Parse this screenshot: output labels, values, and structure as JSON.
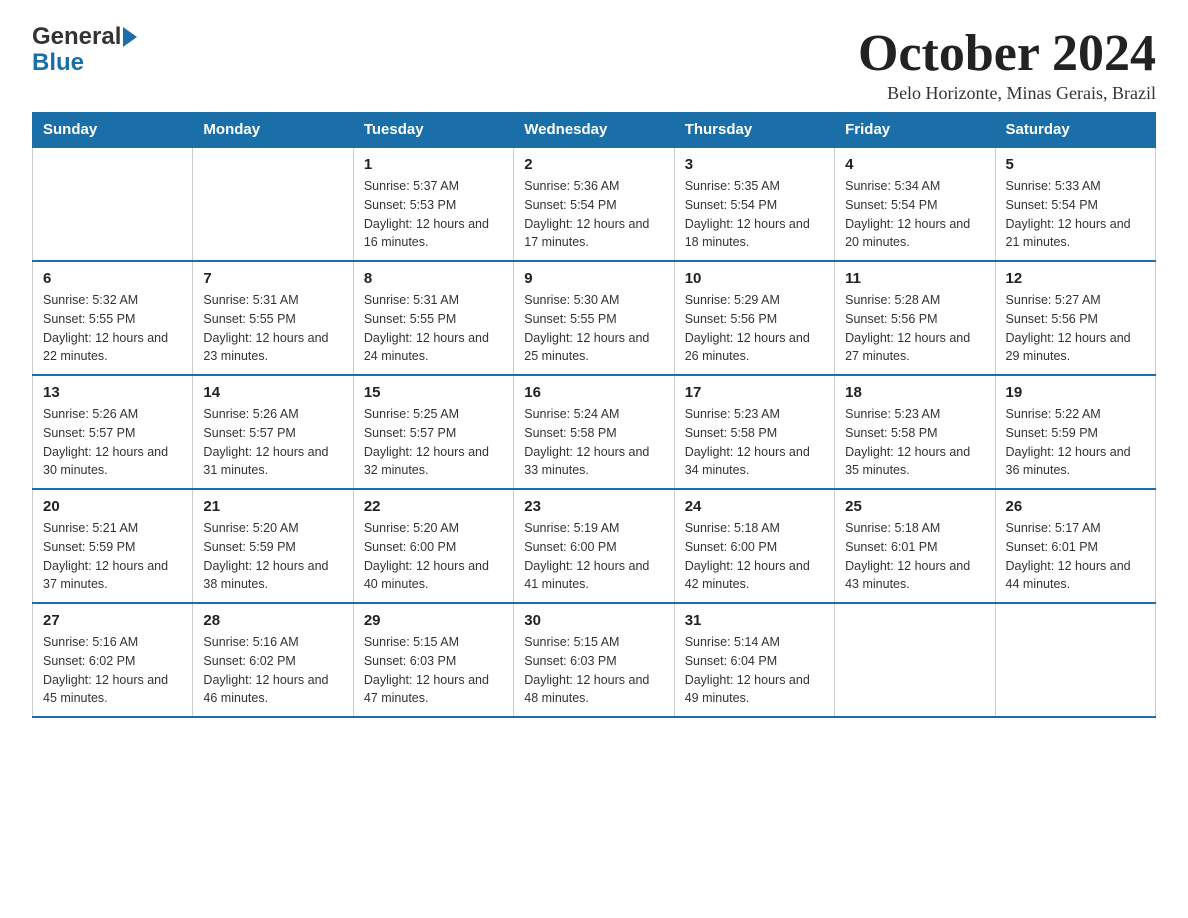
{
  "header": {
    "logo_general": "General",
    "logo_blue": "Blue",
    "month_title": "October 2024",
    "subtitle": "Belo Horizonte, Minas Gerais, Brazil"
  },
  "days_of_week": [
    "Sunday",
    "Monday",
    "Tuesday",
    "Wednesday",
    "Thursday",
    "Friday",
    "Saturday"
  ],
  "weeks": [
    [
      {
        "day": "",
        "sunrise": "",
        "sunset": "",
        "daylight": ""
      },
      {
        "day": "",
        "sunrise": "",
        "sunset": "",
        "daylight": ""
      },
      {
        "day": "1",
        "sunrise": "Sunrise: 5:37 AM",
        "sunset": "Sunset: 5:53 PM",
        "daylight": "Daylight: 12 hours and 16 minutes."
      },
      {
        "day": "2",
        "sunrise": "Sunrise: 5:36 AM",
        "sunset": "Sunset: 5:54 PM",
        "daylight": "Daylight: 12 hours and 17 minutes."
      },
      {
        "day": "3",
        "sunrise": "Sunrise: 5:35 AM",
        "sunset": "Sunset: 5:54 PM",
        "daylight": "Daylight: 12 hours and 18 minutes."
      },
      {
        "day": "4",
        "sunrise": "Sunrise: 5:34 AM",
        "sunset": "Sunset: 5:54 PM",
        "daylight": "Daylight: 12 hours and 20 minutes."
      },
      {
        "day": "5",
        "sunrise": "Sunrise: 5:33 AM",
        "sunset": "Sunset: 5:54 PM",
        "daylight": "Daylight: 12 hours and 21 minutes."
      }
    ],
    [
      {
        "day": "6",
        "sunrise": "Sunrise: 5:32 AM",
        "sunset": "Sunset: 5:55 PM",
        "daylight": "Daylight: 12 hours and 22 minutes."
      },
      {
        "day": "7",
        "sunrise": "Sunrise: 5:31 AM",
        "sunset": "Sunset: 5:55 PM",
        "daylight": "Daylight: 12 hours and 23 minutes."
      },
      {
        "day": "8",
        "sunrise": "Sunrise: 5:31 AM",
        "sunset": "Sunset: 5:55 PM",
        "daylight": "Daylight: 12 hours and 24 minutes."
      },
      {
        "day": "9",
        "sunrise": "Sunrise: 5:30 AM",
        "sunset": "Sunset: 5:55 PM",
        "daylight": "Daylight: 12 hours and 25 minutes."
      },
      {
        "day": "10",
        "sunrise": "Sunrise: 5:29 AM",
        "sunset": "Sunset: 5:56 PM",
        "daylight": "Daylight: 12 hours and 26 minutes."
      },
      {
        "day": "11",
        "sunrise": "Sunrise: 5:28 AM",
        "sunset": "Sunset: 5:56 PM",
        "daylight": "Daylight: 12 hours and 27 minutes."
      },
      {
        "day": "12",
        "sunrise": "Sunrise: 5:27 AM",
        "sunset": "Sunset: 5:56 PM",
        "daylight": "Daylight: 12 hours and 29 minutes."
      }
    ],
    [
      {
        "day": "13",
        "sunrise": "Sunrise: 5:26 AM",
        "sunset": "Sunset: 5:57 PM",
        "daylight": "Daylight: 12 hours and 30 minutes."
      },
      {
        "day": "14",
        "sunrise": "Sunrise: 5:26 AM",
        "sunset": "Sunset: 5:57 PM",
        "daylight": "Daylight: 12 hours and 31 minutes."
      },
      {
        "day": "15",
        "sunrise": "Sunrise: 5:25 AM",
        "sunset": "Sunset: 5:57 PM",
        "daylight": "Daylight: 12 hours and 32 minutes."
      },
      {
        "day": "16",
        "sunrise": "Sunrise: 5:24 AM",
        "sunset": "Sunset: 5:58 PM",
        "daylight": "Daylight: 12 hours and 33 minutes."
      },
      {
        "day": "17",
        "sunrise": "Sunrise: 5:23 AM",
        "sunset": "Sunset: 5:58 PM",
        "daylight": "Daylight: 12 hours and 34 minutes."
      },
      {
        "day": "18",
        "sunrise": "Sunrise: 5:23 AM",
        "sunset": "Sunset: 5:58 PM",
        "daylight": "Daylight: 12 hours and 35 minutes."
      },
      {
        "day": "19",
        "sunrise": "Sunrise: 5:22 AM",
        "sunset": "Sunset: 5:59 PM",
        "daylight": "Daylight: 12 hours and 36 minutes."
      }
    ],
    [
      {
        "day": "20",
        "sunrise": "Sunrise: 5:21 AM",
        "sunset": "Sunset: 5:59 PM",
        "daylight": "Daylight: 12 hours and 37 minutes."
      },
      {
        "day": "21",
        "sunrise": "Sunrise: 5:20 AM",
        "sunset": "Sunset: 5:59 PM",
        "daylight": "Daylight: 12 hours and 38 minutes."
      },
      {
        "day": "22",
        "sunrise": "Sunrise: 5:20 AM",
        "sunset": "Sunset: 6:00 PM",
        "daylight": "Daylight: 12 hours and 40 minutes."
      },
      {
        "day": "23",
        "sunrise": "Sunrise: 5:19 AM",
        "sunset": "Sunset: 6:00 PM",
        "daylight": "Daylight: 12 hours and 41 minutes."
      },
      {
        "day": "24",
        "sunrise": "Sunrise: 5:18 AM",
        "sunset": "Sunset: 6:00 PM",
        "daylight": "Daylight: 12 hours and 42 minutes."
      },
      {
        "day": "25",
        "sunrise": "Sunrise: 5:18 AM",
        "sunset": "Sunset: 6:01 PM",
        "daylight": "Daylight: 12 hours and 43 minutes."
      },
      {
        "day": "26",
        "sunrise": "Sunrise: 5:17 AM",
        "sunset": "Sunset: 6:01 PM",
        "daylight": "Daylight: 12 hours and 44 minutes."
      }
    ],
    [
      {
        "day": "27",
        "sunrise": "Sunrise: 5:16 AM",
        "sunset": "Sunset: 6:02 PM",
        "daylight": "Daylight: 12 hours and 45 minutes."
      },
      {
        "day": "28",
        "sunrise": "Sunrise: 5:16 AM",
        "sunset": "Sunset: 6:02 PM",
        "daylight": "Daylight: 12 hours and 46 minutes."
      },
      {
        "day": "29",
        "sunrise": "Sunrise: 5:15 AM",
        "sunset": "Sunset: 6:03 PM",
        "daylight": "Daylight: 12 hours and 47 minutes."
      },
      {
        "day": "30",
        "sunrise": "Sunrise: 5:15 AM",
        "sunset": "Sunset: 6:03 PM",
        "daylight": "Daylight: 12 hours and 48 minutes."
      },
      {
        "day": "31",
        "sunrise": "Sunrise: 5:14 AM",
        "sunset": "Sunset: 6:04 PM",
        "daylight": "Daylight: 12 hours and 49 minutes."
      },
      {
        "day": "",
        "sunrise": "",
        "sunset": "",
        "daylight": ""
      },
      {
        "day": "",
        "sunrise": "",
        "sunset": "",
        "daylight": ""
      }
    ]
  ]
}
